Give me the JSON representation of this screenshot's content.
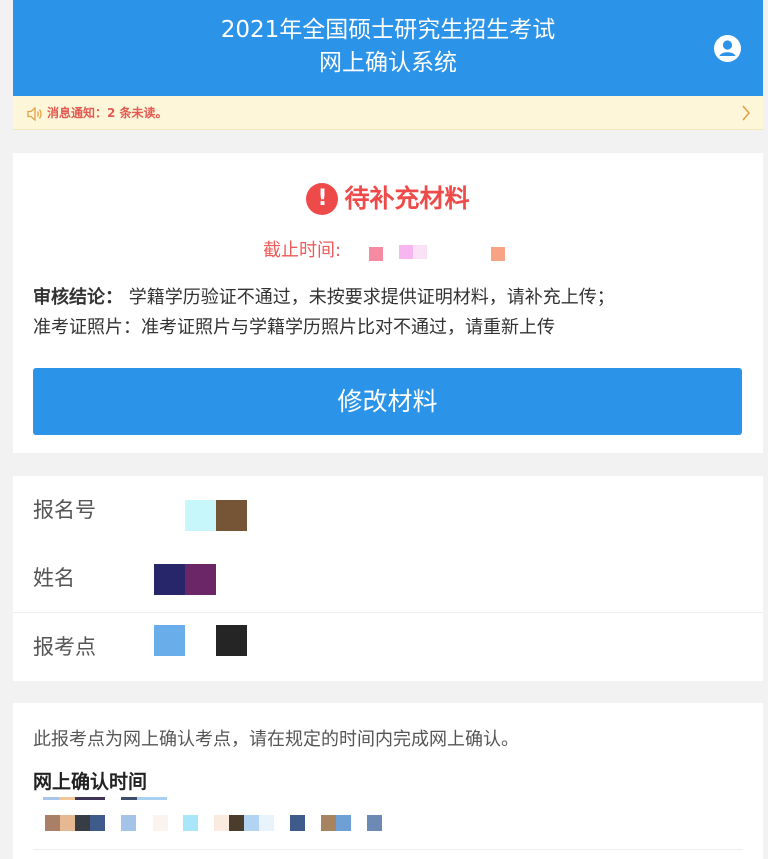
{
  "header": {
    "title_line1": "2021年全国硕士研究生招生考试",
    "title_line2": "网上确认系统",
    "user_icon": "user-circle-icon"
  },
  "notice": {
    "text": "消息通知：2 条未读。",
    "icon": "speaker-icon",
    "arrow_icon": "chevron-right-icon"
  },
  "status": {
    "icon": "exclamation-circle-icon",
    "label": "待补充材料",
    "deadline_label": "截止时间: "
  },
  "review": {
    "conclusion_label": "审核结论：",
    "conclusion_text": "学籍学历验证不通过，未按要求提供证明材料，请补充上传；",
    "photo_line": "准考证照片：准考证照片与学籍学历照片比对不通过，请重新上传"
  },
  "action": {
    "modify_button": "修改材料"
  },
  "fields": [
    {
      "label": "报名号"
    },
    {
      "label": "姓名"
    },
    {
      "label": "报考点"
    }
  ],
  "confirm": {
    "info": "此报考点为网上确认考点，请在规定的时间内完成网上确认。",
    "time_title": "网上确认时间"
  },
  "colors": {
    "primary": "#2b93e8",
    "danger": "#ef4a4a",
    "notice_bg": "#fdf6d8"
  }
}
